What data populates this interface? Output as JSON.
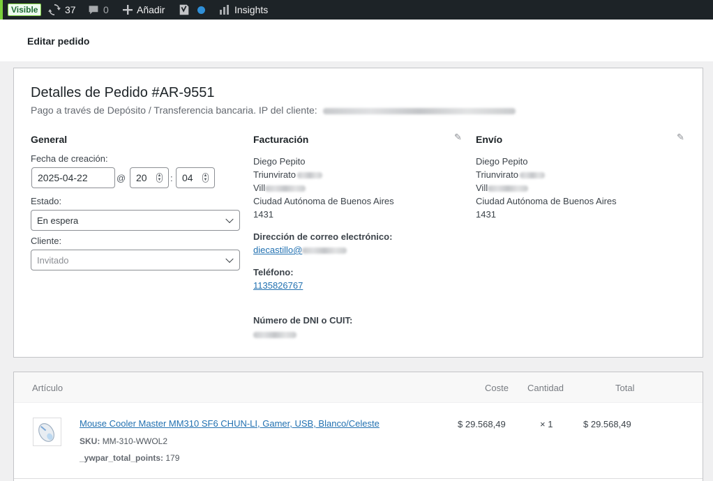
{
  "adminbar": {
    "visible_badge": "Visible",
    "updates_count": "37",
    "comments_count": "0",
    "add_label": "Añadir",
    "insights_label": "Insights"
  },
  "header": {
    "title": "Editar pedido"
  },
  "order": {
    "title": "Detalles de Pedido #AR-9551",
    "payment_line": "Pago a través de Depósito / Transferencia bancaria. IP del cliente:"
  },
  "general": {
    "heading": "General",
    "date_label": "Fecha de creación:",
    "date_value": "2025-04-22",
    "at_sign": "@",
    "hour": "20",
    "colon": ":",
    "minute": "04",
    "status_label": "Estado:",
    "status_value": "En espera",
    "customer_label": "Cliente:",
    "customer_placeholder": "Invitado"
  },
  "billing": {
    "heading": "Facturación",
    "name": "Diego Pepito",
    "street": "Triunvirato",
    "locality": "Vill",
    "city": "Ciudad Autónoma de Buenos Aires",
    "postcode": "1431",
    "email_label": "Dirección de correo electrónico:",
    "email": "diecastillo@",
    "phone_label": "Teléfono:",
    "phone": "1135826767",
    "dni_label": "Número de DNI o CUIT:"
  },
  "shipping": {
    "heading": "Envío",
    "name": "Diego Pepito",
    "street": "Triunvirato",
    "locality": "Vill",
    "city": "Ciudad Autónoma de Buenos Aires",
    "postcode": "1431"
  },
  "items": {
    "columns": {
      "item": "Artículo",
      "cost": "Coste",
      "qty": "Cantidad",
      "total": "Total"
    },
    "rows": [
      {
        "name": "Mouse Cooler Master MM310 SF6 CHUN-LI, Gamer, USB, Blanco/Celeste",
        "sku_label": "SKU:",
        "sku": "MM-310-WWOL2",
        "points_label": "_ywpar_total_points:",
        "points": "179",
        "cost": "$ 29.568,49",
        "qty": "× 1",
        "total": "$ 29.568,49"
      }
    ]
  },
  "icons": [
    "refresh-icon",
    "comment-icon",
    "plus-icon",
    "yoast-icon",
    "status-dot-icon",
    "insights-icon",
    "pencil-icon",
    "mouse-thumbnail"
  ],
  "colors": {
    "adminbar": "#1d2327",
    "link": "#2271b1",
    "badge_green": "#7ad03a"
  }
}
